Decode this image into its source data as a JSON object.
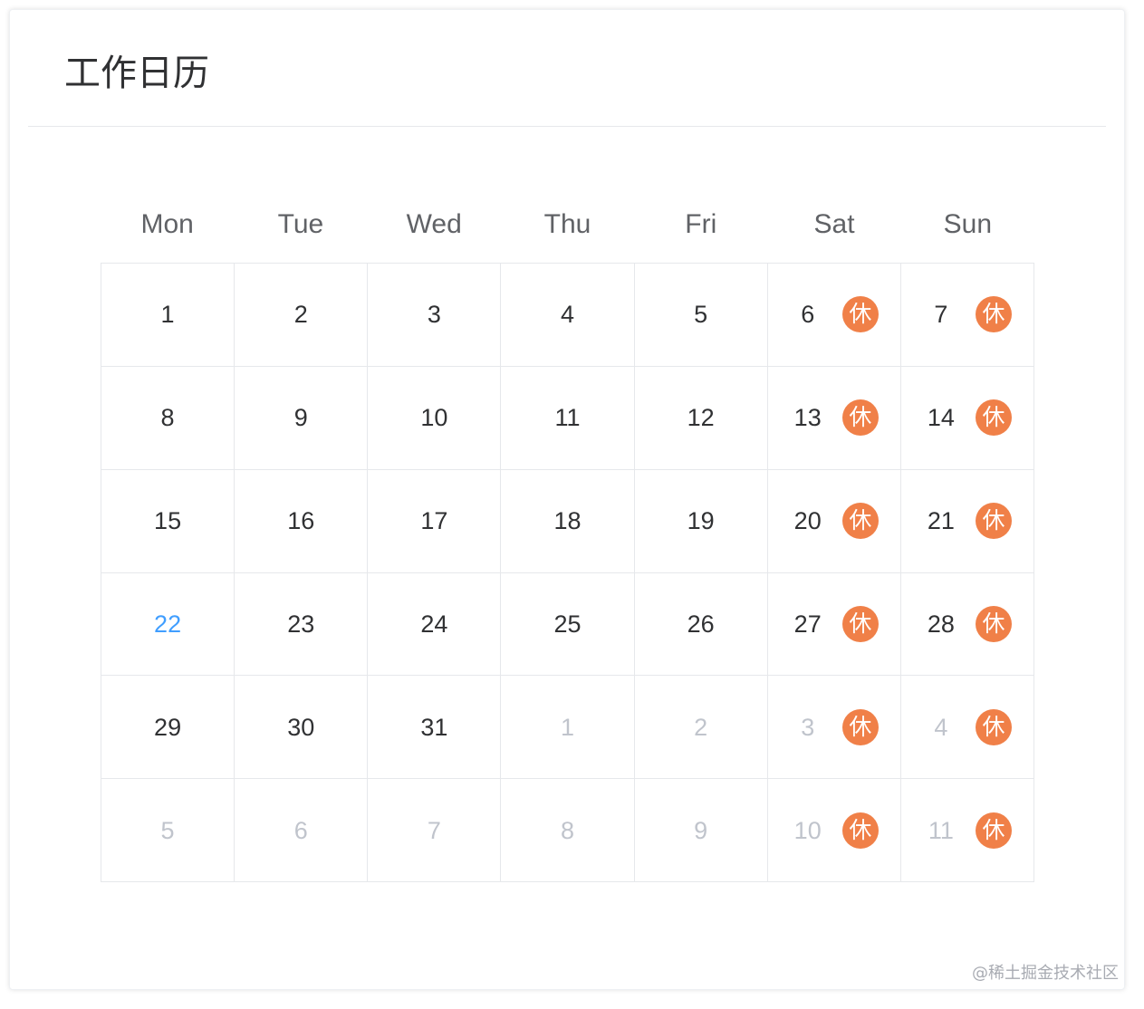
{
  "card": {
    "title": "工作日历"
  },
  "weekdays": [
    "Mon",
    "Tue",
    "Wed",
    "Thu",
    "Fri",
    "Sat",
    "Sun"
  ],
  "rest_badge_label": "休",
  "colors": {
    "rest_badge": "#f08048",
    "today": "#409eff",
    "other_month": "#c0c4cc",
    "day_text": "#303133"
  },
  "weeks": [
    [
      {
        "day": "1",
        "state": "current",
        "rest": false
      },
      {
        "day": "2",
        "state": "current",
        "rest": false
      },
      {
        "day": "3",
        "state": "current",
        "rest": false
      },
      {
        "day": "4",
        "state": "current",
        "rest": false
      },
      {
        "day": "5",
        "state": "current",
        "rest": false
      },
      {
        "day": "6",
        "state": "current",
        "rest": true
      },
      {
        "day": "7",
        "state": "current",
        "rest": true
      }
    ],
    [
      {
        "day": "8",
        "state": "current",
        "rest": false
      },
      {
        "day": "9",
        "state": "current",
        "rest": false
      },
      {
        "day": "10",
        "state": "current",
        "rest": false
      },
      {
        "day": "11",
        "state": "current",
        "rest": false
      },
      {
        "day": "12",
        "state": "current",
        "rest": false
      },
      {
        "day": "13",
        "state": "current",
        "rest": true
      },
      {
        "day": "14",
        "state": "current",
        "rest": true
      }
    ],
    [
      {
        "day": "15",
        "state": "current",
        "rest": false
      },
      {
        "day": "16",
        "state": "current",
        "rest": false
      },
      {
        "day": "17",
        "state": "current",
        "rest": false
      },
      {
        "day": "18",
        "state": "current",
        "rest": false
      },
      {
        "day": "19",
        "state": "current",
        "rest": false
      },
      {
        "day": "20",
        "state": "current",
        "rest": true
      },
      {
        "day": "21",
        "state": "current",
        "rest": true
      }
    ],
    [
      {
        "day": "22",
        "state": "today",
        "rest": false
      },
      {
        "day": "23",
        "state": "current",
        "rest": false
      },
      {
        "day": "24",
        "state": "current",
        "rest": false
      },
      {
        "day": "25",
        "state": "current",
        "rest": false
      },
      {
        "day": "26",
        "state": "current",
        "rest": false
      },
      {
        "day": "27",
        "state": "current",
        "rest": true
      },
      {
        "day": "28",
        "state": "current",
        "rest": true
      }
    ],
    [
      {
        "day": "29",
        "state": "current",
        "rest": false
      },
      {
        "day": "30",
        "state": "current",
        "rest": false
      },
      {
        "day": "31",
        "state": "current",
        "rest": false
      },
      {
        "day": "1",
        "state": "other",
        "rest": false
      },
      {
        "day": "2",
        "state": "other",
        "rest": false
      },
      {
        "day": "3",
        "state": "other",
        "rest": true
      },
      {
        "day": "4",
        "state": "other",
        "rest": true
      }
    ],
    [
      {
        "day": "5",
        "state": "other",
        "rest": false
      },
      {
        "day": "6",
        "state": "other",
        "rest": false
      },
      {
        "day": "7",
        "state": "other",
        "rest": false
      },
      {
        "day": "8",
        "state": "other",
        "rest": false
      },
      {
        "day": "9",
        "state": "other",
        "rest": false
      },
      {
        "day": "10",
        "state": "other",
        "rest": true
      },
      {
        "day": "11",
        "state": "other",
        "rest": true
      }
    ]
  ],
  "watermark": "@稀土掘金技术社区"
}
